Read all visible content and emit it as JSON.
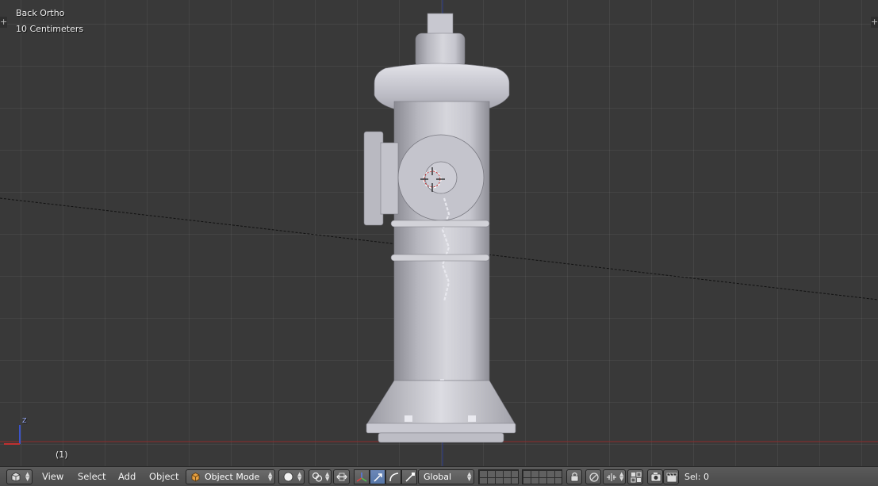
{
  "viewport": {
    "view_name": "Back Ortho",
    "grid_scale": "10 Centimeters",
    "frame_number": "(1)",
    "axis_label": "Z",
    "scene_object": "fire-hydrant",
    "colors": {
      "background": "#393939",
      "x_axis": "#8e2a2a",
      "z_axis": "#3b53c8",
      "hydrant_body": "#b9b9c1"
    }
  },
  "header": {
    "menus": {
      "view": "View",
      "select": "Select",
      "add": "Add",
      "object": "Object"
    },
    "mode": "Object Mode",
    "orientation": "Global",
    "sel": "Sel: 0",
    "icons": [
      "editor-type-icon",
      "viewport-shading-icon",
      "pivot-point-icon",
      "manipulator-icon",
      "translate-icon",
      "rotate-icon",
      "scale-icon",
      "layer-grid-icon",
      "lock-icon",
      "snap-icon",
      "snap-element-icon",
      "proportional-edit-icon",
      "render-icon",
      "clapper-icon"
    ]
  }
}
